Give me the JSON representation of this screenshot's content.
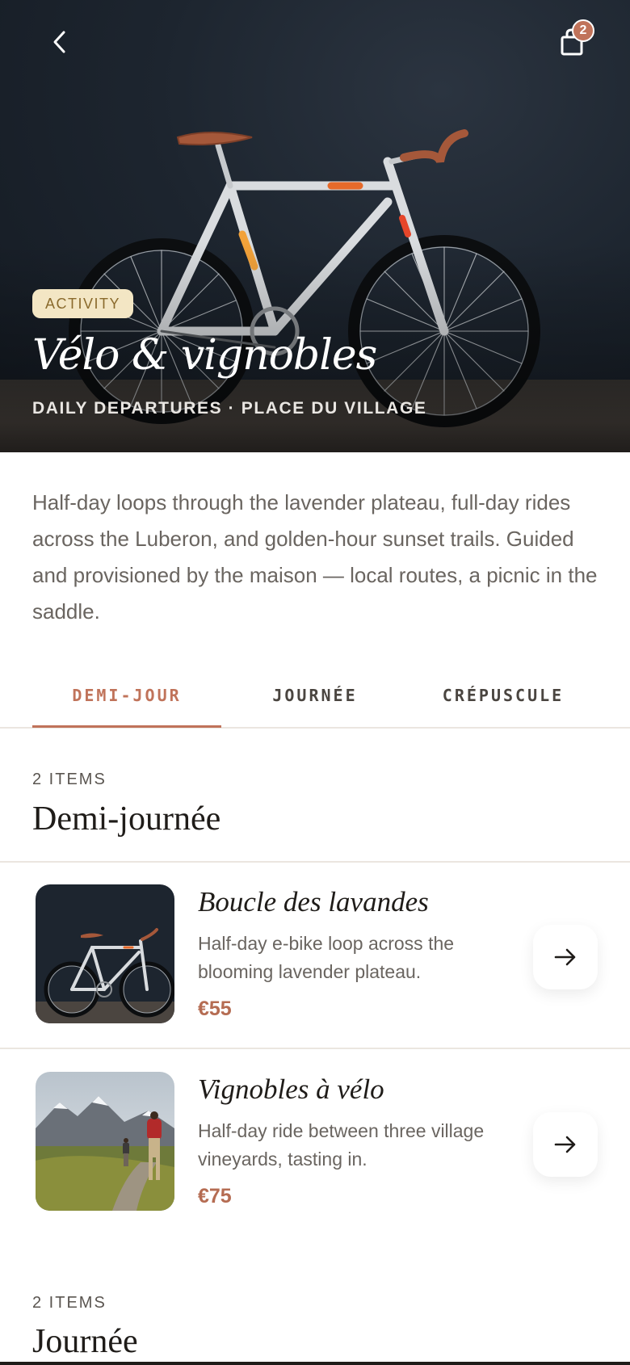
{
  "header": {
    "back_icon": "chevron-left-icon",
    "cart_icon": "shopping-bag-icon",
    "cart_count": "2"
  },
  "hero": {
    "tag": "ACTIVITY",
    "title": "Vélo & vignobles",
    "subtitle": "DAILY DEPARTURES · PLACE DU VILLAGE",
    "image": "vintage-road-bicycle-photo"
  },
  "description": "Half-day loops through the lavender plateau, full-day rides across the Luberon, and golden-hour sunset trails. Guided and provisioned by the maison — local routes, a picnic in the saddle.",
  "tabs": [
    {
      "label": "DEMI-JOUR",
      "active": true
    },
    {
      "label": "JOURNÉE",
      "active": false
    },
    {
      "label": "CRÉPUSCULE",
      "active": false
    }
  ],
  "sections": [
    {
      "count": "2 ITEMS",
      "title": "Demi-journée",
      "items": [
        {
          "name": "Boucle des lavandes",
          "desc": "Half-day e-bike loop across the blooming lavender plateau.",
          "price": "€55",
          "image": "bicycle-photo",
          "action_icon": "arrow-right-icon"
        },
        {
          "name": "Vignobles à vélo",
          "desc": "Half-day ride between three village vineyards, tasting in.",
          "price": "€75",
          "image": "mountain-hikers-photo",
          "action_icon": "arrow-right-icon"
        }
      ]
    },
    {
      "count": "2 ITEMS",
      "title": "Journée"
    }
  ],
  "colors": {
    "accent": "#c0735a",
    "price": "#b56c52",
    "tag_bg": "#f3e6c4",
    "tag_text": "#8a6a2c",
    "text_muted": "#6a6560"
  }
}
